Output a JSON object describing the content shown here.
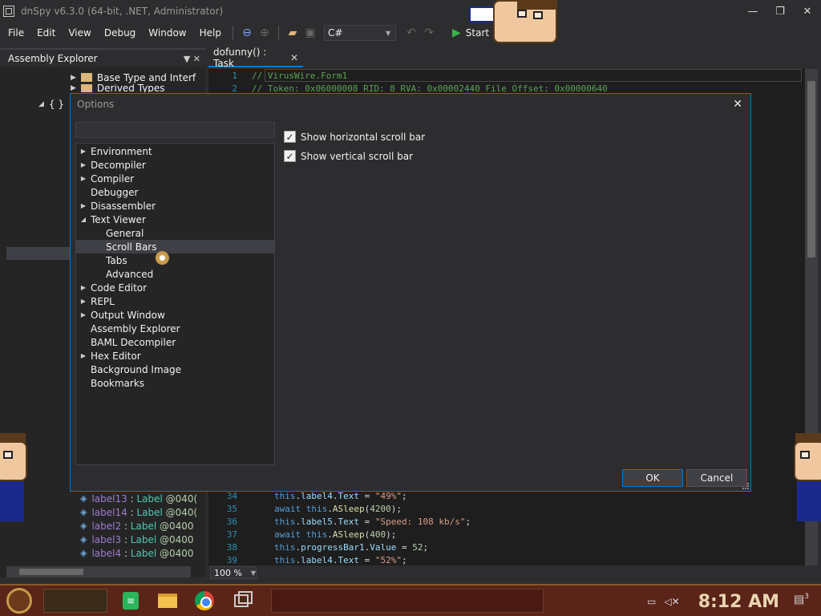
{
  "window": {
    "title": "dnSpy v6.3.0 (64-bit, .NET, Administrator)",
    "minimize": "—",
    "maximize": "❐",
    "close": "✕"
  },
  "menu": {
    "items": [
      "File",
      "Edit",
      "View",
      "Debug",
      "Window",
      "Help"
    ]
  },
  "toolbar": {
    "language": "C#",
    "start_label": "Start"
  },
  "assembly_explorer": {
    "title": "Assembly Explorer",
    "tree": [
      {
        "label": "Base Type and Interf"
      },
      {
        "label": "Derived Types"
      }
    ],
    "namespace_glyph": "{ }",
    "labels": [
      {
        "name": "label13",
        "type": "Label",
        "addr": "@040("
      },
      {
        "name": "label14",
        "type": "Label",
        "addr": "@040("
      },
      {
        "name": "label2",
        "type": "Label",
        "addr": "@0400"
      },
      {
        "name": "label3",
        "type": "Label",
        "addr": "@0400"
      },
      {
        "name": "label4",
        "type": "Label",
        "addr": "@0400"
      }
    ]
  },
  "editor": {
    "tab_title": "dofunny() : Task",
    "line1": {
      "num": "1",
      "text": "// VirusWire.Form1"
    },
    "line2": {
      "num": "2",
      "text": "// Token: 0x06000008 RID: 8 RVA: 0x00002440 File Offset: 0x00000640"
    },
    "lines": [
      {
        "num": "34",
        "obj": "this",
        "field": "label4",
        "prop": "Text",
        "op": " = ",
        "val": "\"49%\"",
        "end": ";"
      },
      {
        "num": "35",
        "kw": "await",
        "obj": "this",
        "method": "ASleep",
        "arg": "4200"
      },
      {
        "num": "36",
        "obj": "this",
        "field": "label5",
        "prop": "Text",
        "op": " = ",
        "val": "\"Speed: 108 kb/s\"",
        "end": ";"
      },
      {
        "num": "37",
        "kw": "await",
        "obj": "this",
        "method": "ASleep",
        "arg": "400"
      },
      {
        "num": "38",
        "obj": "this",
        "field": "progressBar1",
        "prop": "Value",
        "op": " = ",
        "num_val": "52",
        "end": ";"
      },
      {
        "num": "39",
        "obj": "this",
        "field": "label4",
        "prop": "Text",
        "op": " = ",
        "val": "\"52%\"",
        "end": ";"
      }
    ],
    "zoom": "100 %"
  },
  "options_dialog": {
    "title": "Options",
    "close": "✕",
    "tree": [
      {
        "label": "Environment",
        "expander": "▶"
      },
      {
        "label": "Decompiler",
        "expander": "▶"
      },
      {
        "label": "Compiler",
        "expander": "▶"
      },
      {
        "label": "Debugger",
        "expander": ""
      },
      {
        "label": "Disassembler",
        "expander": "▶"
      },
      {
        "label": "Text Viewer",
        "expander": "◢"
      },
      {
        "label": "General",
        "expander": "",
        "child": true
      },
      {
        "label": "Scroll Bars",
        "expander": "",
        "child": true,
        "selected": true
      },
      {
        "label": "Tabs",
        "expander": "",
        "child": true
      },
      {
        "label": "Advanced",
        "expander": "",
        "child": true
      },
      {
        "label": "Code Editor",
        "expander": "▶"
      },
      {
        "label": "REPL",
        "expander": "▶"
      },
      {
        "label": "Output Window",
        "expander": "▶"
      },
      {
        "label": "Assembly Explorer",
        "expander": ""
      },
      {
        "label": "BAML Decompiler",
        "expander": ""
      },
      {
        "label": "Hex Editor",
        "expander": "▶"
      },
      {
        "label": "Background Image",
        "expander": ""
      },
      {
        "label": "Bookmarks",
        "expander": ""
      }
    ],
    "checkboxes": [
      {
        "label": "Show horizontal scroll bar",
        "checked": true
      },
      {
        "label": "Show vertical scroll bar",
        "checked": true
      }
    ],
    "ok_label": "OK",
    "cancel_label": "Cancel"
  },
  "taskbar": {
    "clock": "8:12 AM",
    "notification_count": "3"
  },
  "colors": {
    "accent": "#007acc",
    "background": "#2d2d30",
    "editor_bg": "#1e1e1e"
  }
}
